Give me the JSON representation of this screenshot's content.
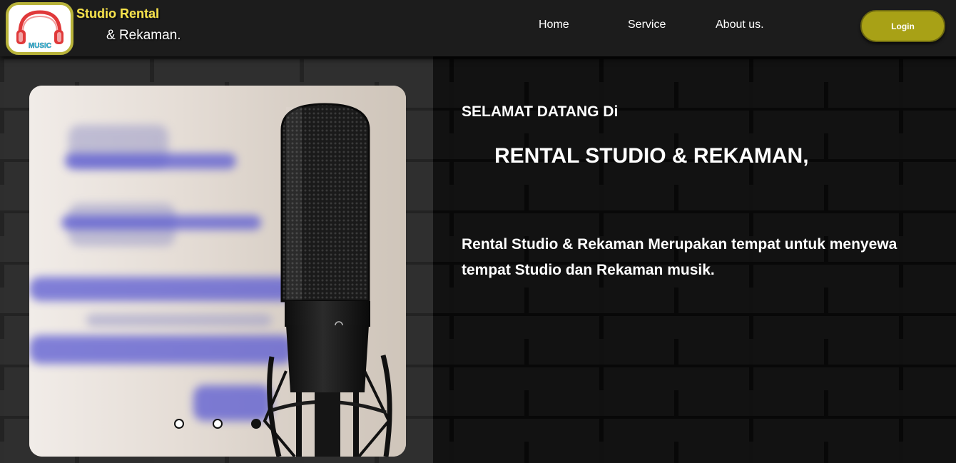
{
  "brand": {
    "logo_text": "MUSIC",
    "line1": "Studio Rental",
    "line2": "& Rekaman."
  },
  "nav": {
    "items": [
      {
        "label": "Home"
      },
      {
        "label": "Service"
      },
      {
        "label": "About us."
      }
    ],
    "login_label": "Login"
  },
  "hero": {
    "welcome": "SELAMAT DATANG Di",
    "headline": "RENTAL STUDIO & REKAMAN,",
    "description": "Rental Studio & Rekaman Merupakan tempat untuk menyewa tempat Studio dan Rekaman musik."
  },
  "carousel": {
    "image": "studio-microphone-image",
    "slide_count": 3,
    "active_slide": 3
  },
  "colors": {
    "accent_gold": "#a8a116",
    "brand_yellow": "#f7e24a",
    "logo_border": "#b8b33a",
    "headphone_red": "#e0393a",
    "logo_text_cyan": "#3fc8e6"
  }
}
